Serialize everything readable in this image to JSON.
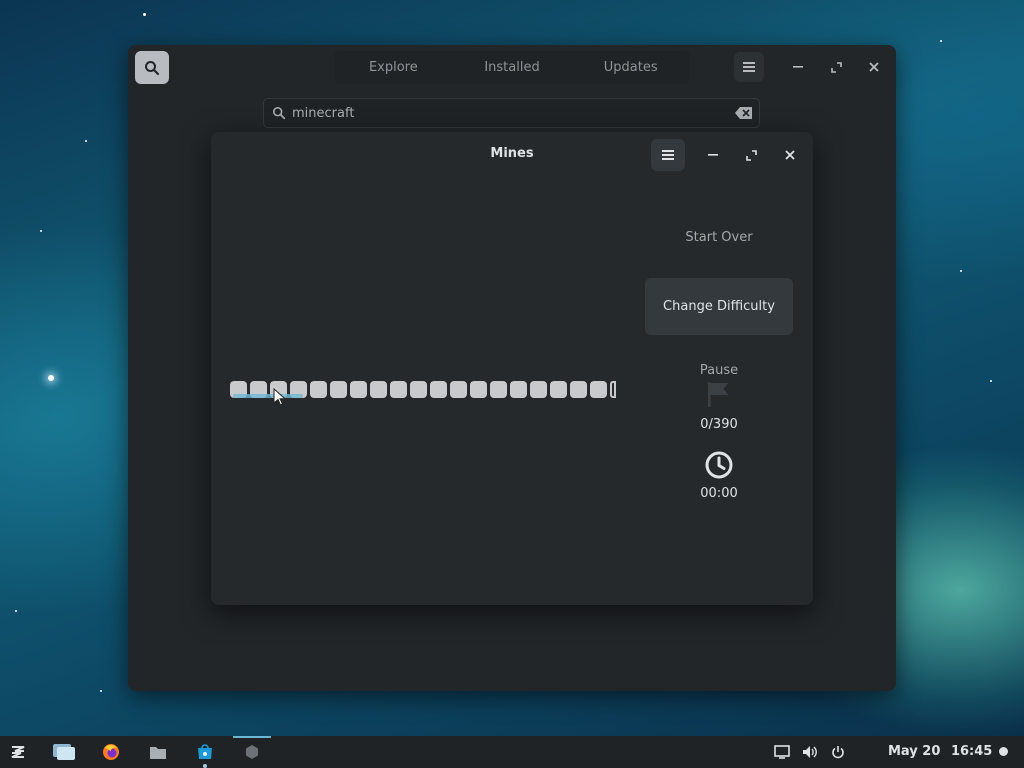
{
  "software": {
    "tabs": [
      "Explore",
      "Installed",
      "Updates"
    ],
    "search_value": "minecraft",
    "icons": [
      "search-icon",
      "menu-icon",
      "minimize-icon",
      "maximize-icon",
      "close-icon",
      "clear-icon"
    ]
  },
  "mines": {
    "title": "Mines",
    "start_over_label": "Start Over",
    "change_difficulty_label": "Change Difficulty",
    "pause_label": "Pause",
    "flag_count": "0/390",
    "timer": "00:00",
    "board_visible_cells": 19
  },
  "taskbar": {
    "date": "May 20",
    "time": "16:45",
    "icons": [
      "zorin-menu-icon",
      "workspaces-icon",
      "firefox-icon",
      "files-icon",
      "software-store-icon",
      "mines-app-icon",
      "display-icon",
      "volume-icon",
      "power-icon",
      "notification-icon"
    ]
  },
  "colors": {
    "accent": "#6fb7d6",
    "window_bg": "#26292c",
    "cell": "#c8cacb"
  }
}
